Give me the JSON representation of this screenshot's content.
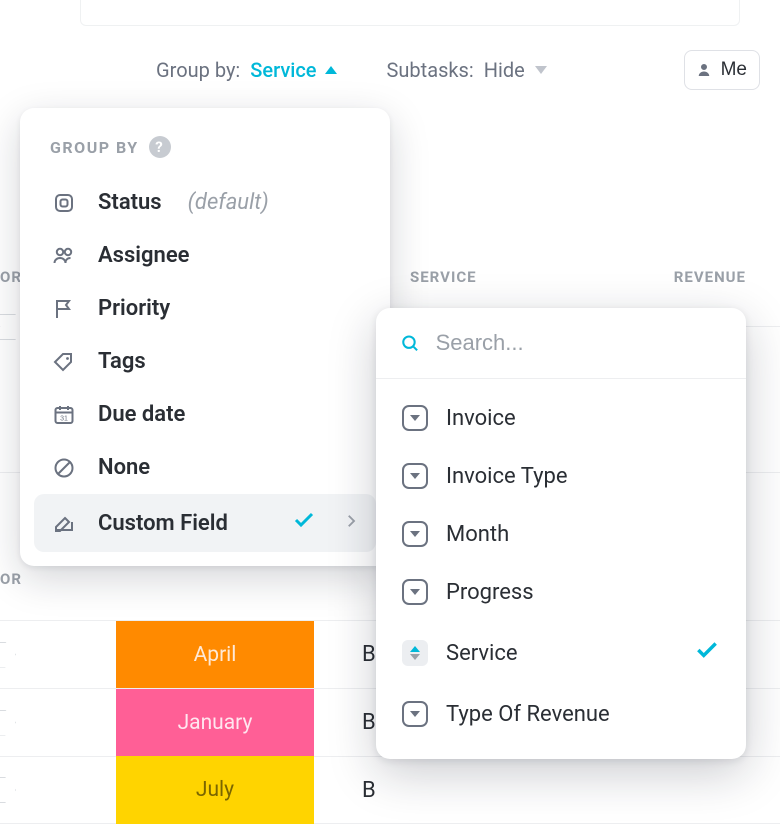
{
  "toolbar": {
    "group_by_label": "Group by:",
    "group_by_value": "Service",
    "subtasks_label": "Subtasks:",
    "subtasks_value": "Hide",
    "me_label": "Me"
  },
  "columns": {
    "left_partial": "OR",
    "service": "SERVICE",
    "revenue": "REVENUE",
    "left_partial2": "OR"
  },
  "groupby": {
    "title": "GROUP BY",
    "items": [
      {
        "icon": "status",
        "label": "Status",
        "suffix": "(default)"
      },
      {
        "icon": "assignee",
        "label": "Assignee"
      },
      {
        "icon": "priority",
        "label": "Priority"
      },
      {
        "icon": "tags",
        "label": "Tags"
      },
      {
        "icon": "duedate",
        "label": "Due date"
      },
      {
        "icon": "none",
        "label": "None"
      },
      {
        "icon": "custom",
        "label": "Custom Field",
        "selected": true,
        "submenu": true
      }
    ]
  },
  "custom_fields": {
    "search_placeholder": "Search...",
    "items": [
      {
        "label": "Invoice"
      },
      {
        "label": "Invoice Type"
      },
      {
        "label": "Month"
      },
      {
        "label": "Progress"
      },
      {
        "label": "Service",
        "active": true,
        "checked": true
      },
      {
        "label": "Type Of Revenue"
      }
    ]
  },
  "rows": [
    {
      "month": "April",
      "color": "#ff8a00",
      "text_color": "#ffe6cc",
      "b": "B"
    },
    {
      "month": "January",
      "color": "#ff5f96",
      "text_color": "#ffe1eb",
      "b": "B"
    },
    {
      "month": "July",
      "color": "#ffd400",
      "text_color": "#7a6900",
      "b": "B"
    }
  ]
}
